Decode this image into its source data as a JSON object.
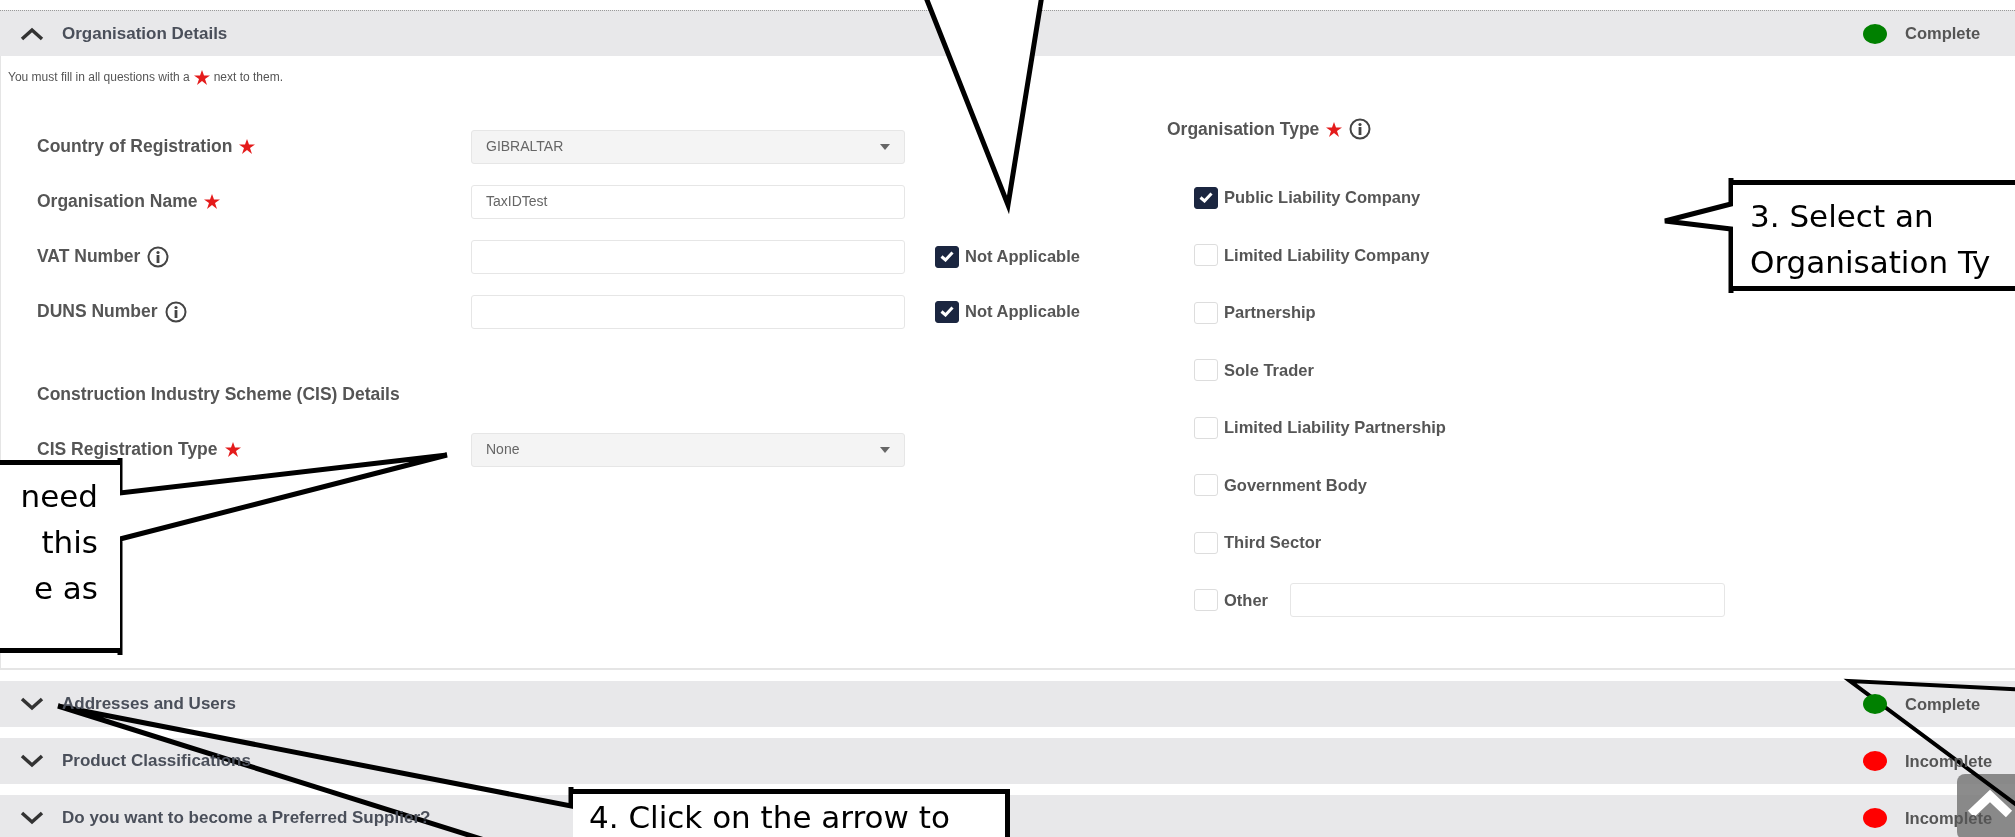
{
  "sections": [
    {
      "title": "Organisation Details",
      "expanded": true,
      "status": "Complete",
      "color": "#008000"
    },
    {
      "title": "Addresses and Users",
      "expanded": false,
      "status": "Complete",
      "color": "#008000"
    },
    {
      "title": "Product Classifications",
      "expanded": false,
      "status": "Incomplete",
      "color": "#ff0000"
    },
    {
      "title": "Do you want to become a Preferred Supplier?",
      "expanded": false,
      "status": "Incomplete",
      "color": "#ff0000"
    }
  ],
  "instruction": {
    "before": "You must fill in all questions with a",
    "after": "next to them."
  },
  "fields": [
    {
      "label": "Country of Registration",
      "kind": "select",
      "value": "GIBRALTAR",
      "required": true
    },
    {
      "label": "Organisation Name",
      "kind": "text",
      "value": "TaxIDTest",
      "required": true
    },
    {
      "label": "VAT Number",
      "kind": "text",
      "info": true,
      "not_applicable": {
        "label": "Not Applicable",
        "checked": true
      }
    },
    {
      "label": "DUNS Number",
      "kind": "text",
      "info": true,
      "not_applicable": {
        "label": "Not Applicable",
        "checked": true
      }
    }
  ],
  "cis": {
    "heading": "Construction Industry Scheme (CIS) Details",
    "label": "CIS Registration Type",
    "required": true,
    "value": "None"
  },
  "organisation_type": {
    "label": "Organisation Type",
    "required": true,
    "info": true,
    "options": [
      {
        "label": "Public Liability Company",
        "checked": true
      },
      {
        "label": "Limited Liability Company",
        "checked": false
      },
      {
        "label": "Partnership",
        "checked": false
      },
      {
        "label": "Sole Trader",
        "checked": false
      },
      {
        "label": "Limited Liability Partnership",
        "checked": false
      },
      {
        "label": "Government Body",
        "checked": false
      },
      {
        "label": "Third Sector",
        "checked": false
      },
      {
        "label": "Other",
        "checked": false,
        "kind": "other"
      }
    ]
  },
  "annotations": [
    {
      "lines": [
        "need",
        "this",
        "e as"
      ]
    },
    {
      "lines": [
        "3. Select an",
        "Organisation Ty"
      ]
    },
    {
      "lines": [
        "4. Click on the arrow to"
      ]
    }
  ]
}
